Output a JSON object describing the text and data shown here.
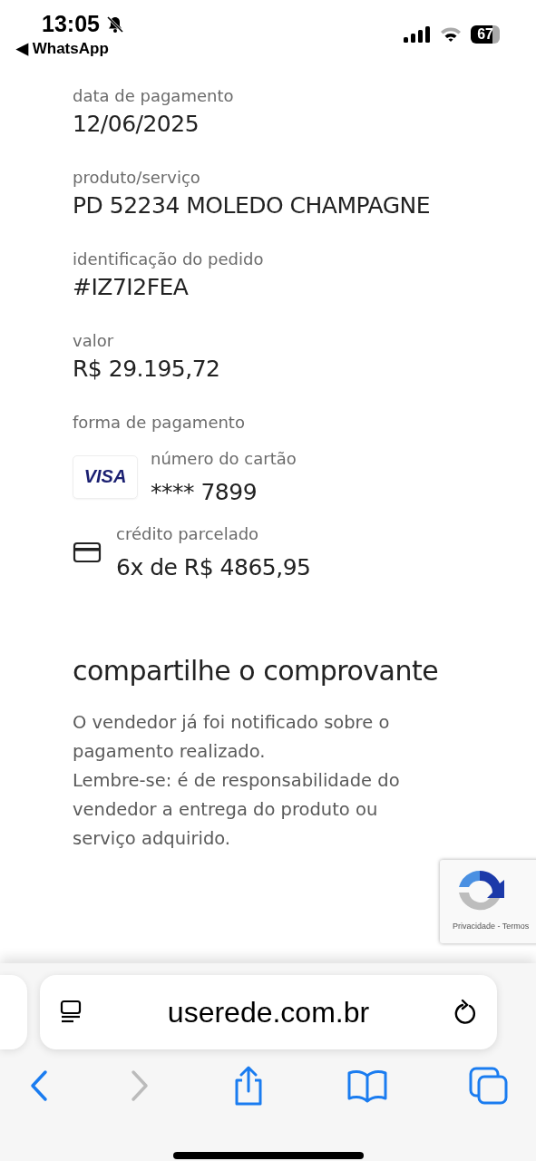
{
  "status_bar": {
    "time": "13:05",
    "back_app": "◀ WhatsApp",
    "battery": "67"
  },
  "fields": [
    {
      "label": "data de pagamento",
      "value": "12/06/2025"
    },
    {
      "label": "produto/serviço",
      "value": "PD 52234 MOLEDO CHAMPAGNE"
    },
    {
      "label": "identificação do pedido",
      "value": "#IZ7I2FEA"
    },
    {
      "label": "valor",
      "value": "R$ 29.195,72"
    }
  ],
  "payment": {
    "title": "forma de pagamento",
    "card": {
      "brand": "VISA",
      "label": "número do cartão",
      "value": "**** 7899"
    },
    "installments": {
      "label": "crédito parcelado",
      "value": "6x de R$ 4865,95"
    }
  },
  "share": {
    "heading": "compartilhe o comprovante",
    "paragraphs": [
      "O vendedor já foi notificado sobre o pagamento realizado.",
      "Lembre-se: é de responsabilidade do vendedor a entrega do produto ou serviço adquirido."
    ]
  },
  "recaptcha": {
    "links": "Privacidade - Termos"
  },
  "browser": {
    "url": "userede.com.br",
    "back_disabled": false,
    "forward_disabled": true
  }
}
